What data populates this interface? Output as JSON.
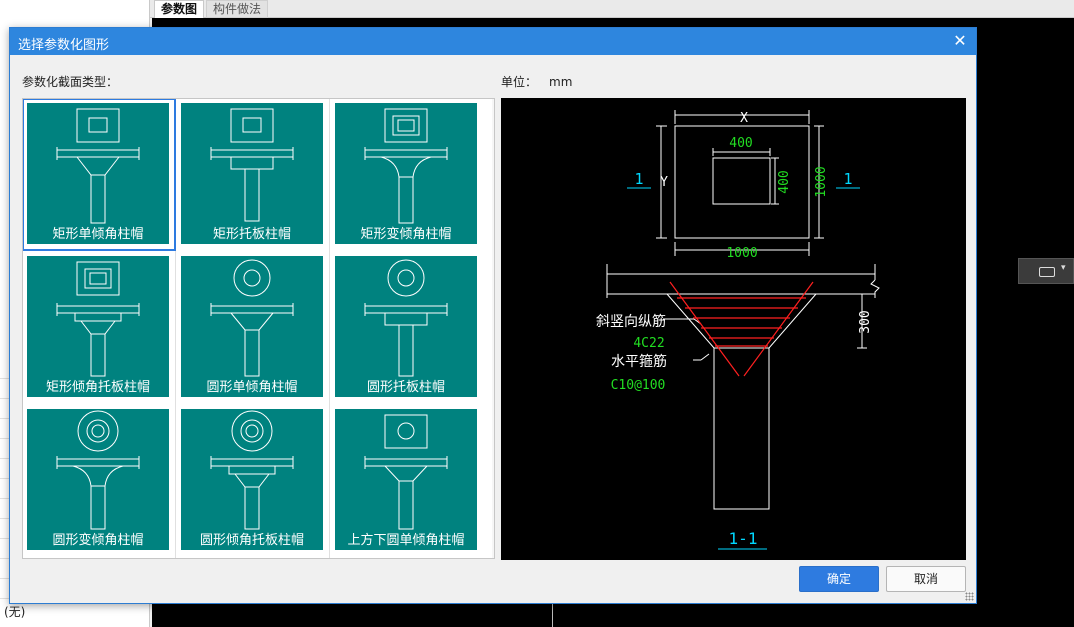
{
  "background": {
    "tabs": [
      {
        "label": "参数图"
      },
      {
        "label": "构件做法"
      }
    ],
    "left_panel": {
      "none_label": "(无)"
    }
  },
  "dialog": {
    "title": "选择参数化图形",
    "close_icon": "close-icon",
    "section_type_label": "参数化截面类型：",
    "unit_label": "单位：",
    "unit_value": "mm",
    "ok_label": "确定",
    "cancel_label": "取消",
    "shapes": [
      {
        "label": "矩形单倾角柱帽",
        "selected": true
      },
      {
        "label": "矩形托板柱帽",
        "selected": false
      },
      {
        "label": "矩形变倾角柱帽",
        "selected": false
      },
      {
        "label": "矩形倾角托板柱帽",
        "selected": false
      },
      {
        "label": "圆形单倾角柱帽",
        "selected": false
      },
      {
        "label": "圆形托板柱帽",
        "selected": false
      },
      {
        "label": "圆形变倾角柱帽",
        "selected": false
      },
      {
        "label": "圆形倾角托板柱帽",
        "selected": false
      },
      {
        "label": "上方下圆单倾角柱帽",
        "selected": false
      }
    ],
    "preview": {
      "dim_x": "X",
      "dim_y": "Y",
      "dim_inner_w": "400",
      "dim_inner_h": "400",
      "dim_outer_w": "1000",
      "dim_outer_h": "1000",
      "section_mark_left": "1",
      "section_mark_right": "1",
      "label_slant_rebar": "斜竖向纵筋",
      "label_slant_rebar_spec": "4C22",
      "label_stirrup": "水平箍筋",
      "label_stirrup_spec": "C10@100",
      "dim_height": "300",
      "section_title": "1-1"
    },
    "colors": {
      "title_bar": "#2e86de",
      "tile": "#00827f",
      "selection": "#2e7be0",
      "dim_green": "#22dd22",
      "mark_cyan": "#00d8ff",
      "rebar_red": "#ff2020"
    }
  }
}
